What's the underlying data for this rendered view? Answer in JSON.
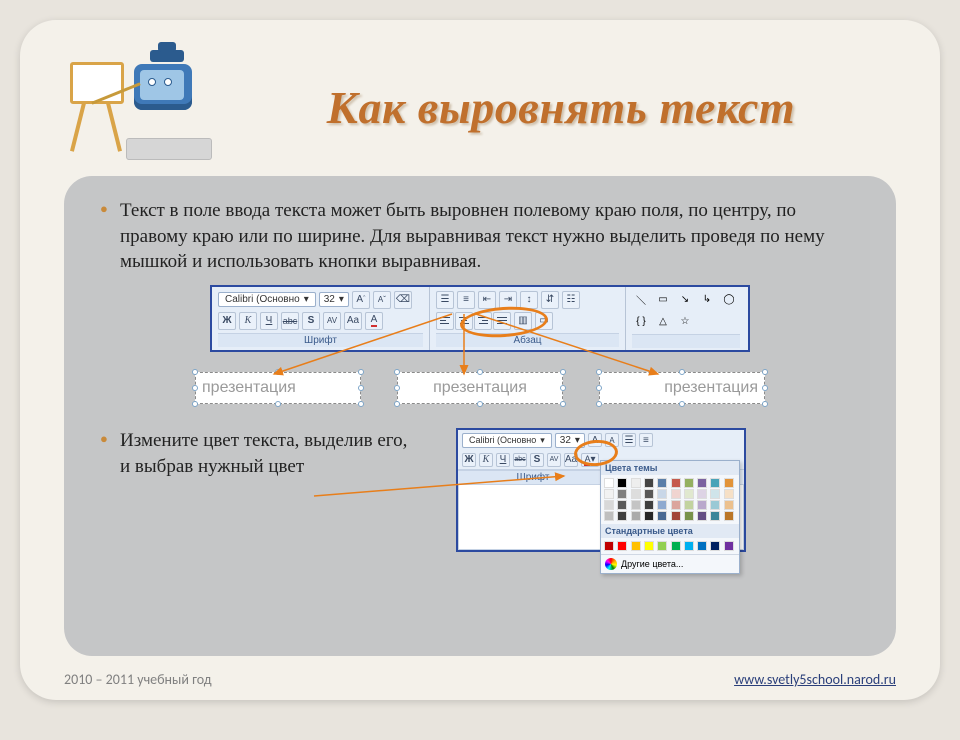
{
  "title": "Как выровнять текст",
  "bullets": {
    "b1": "Текст в поле ввода текста может быть выровнен полевому краю поля, по центру, по правому краю или по ширине. Для выравнивая текст нужно выделить проведя по нему мышкой и использовать кнопки выравнивая.",
    "b2_line1": "Измените цвет текста, выделив его,",
    "b2_line2": "и выбрав нужный цвет"
  },
  "ribbon": {
    "font_family": "Calibri (Основно",
    "font_size": "32",
    "group_font": "Шрифт",
    "group_para": "Абзац",
    "bold": "Ж",
    "italic": "К",
    "underline": "Ч",
    "strike": "abc",
    "shadow": "S",
    "av": "AV",
    "aa": "Aa",
    "a_color": "A"
  },
  "examples": {
    "sample": "презентация"
  },
  "color_panel": {
    "theme_header": "Цвета темы",
    "std_header": "Стандартные цвета",
    "more": "Другие цвета..."
  },
  "footer": {
    "year": "2010 – 2011 учебный год",
    "link": "www.svetly5school.narod.ru"
  }
}
